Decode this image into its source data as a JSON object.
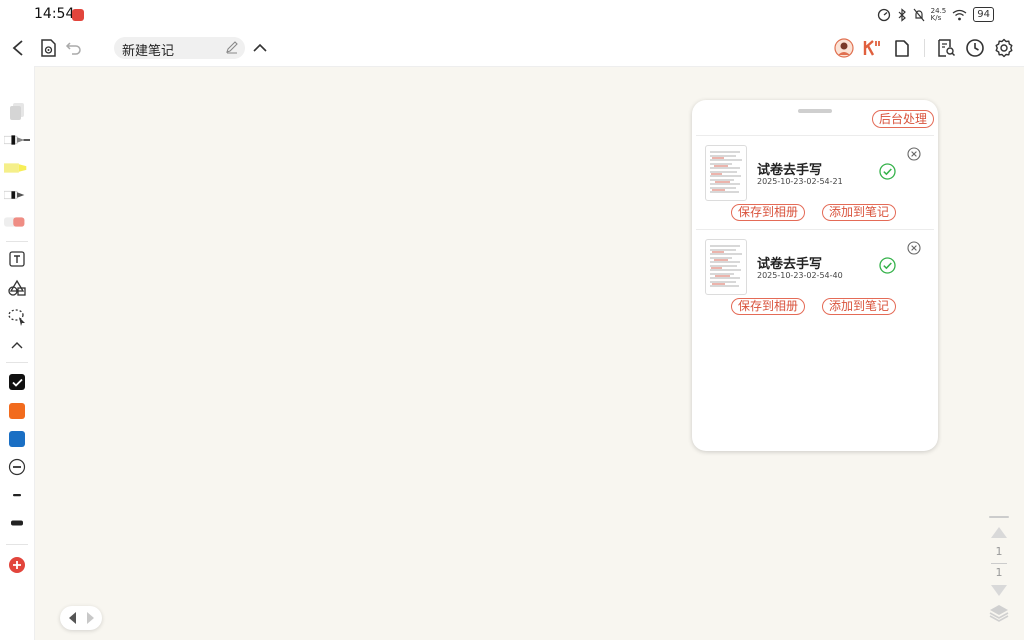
{
  "status": {
    "time": "14:54",
    "net_speed_top": "24.5",
    "net_speed_bottom": "K/s",
    "battery": "94"
  },
  "toolbar": {
    "note_title": "新建笔记"
  },
  "panel": {
    "background_button": "后台处理",
    "tasks": [
      {
        "title": "试卷去手写",
        "timestamp": "2025-10-23-02-54-21",
        "save_label": "保存到相册",
        "add_label": "添加到笔记"
      },
      {
        "title": "试卷去手写",
        "timestamp": "2025-10-23-02-54-40",
        "save_label": "保存到相册",
        "add_label": "添加到笔记"
      }
    ]
  },
  "pager": {
    "current": "1",
    "total": "1"
  },
  "colors": {
    "black": "#111111",
    "orange": "#f26b1d",
    "blue": "#1a6fc4",
    "accent": "#d9533c",
    "check": "#35b24a"
  },
  "icons": [
    "back-icon",
    "reading-mode-icon",
    "undo-icon",
    "chevron-up-icon",
    "avatar",
    "brand-k-icon",
    "page-icon",
    "search-note-icon",
    "history-icon",
    "settings-icon"
  ]
}
